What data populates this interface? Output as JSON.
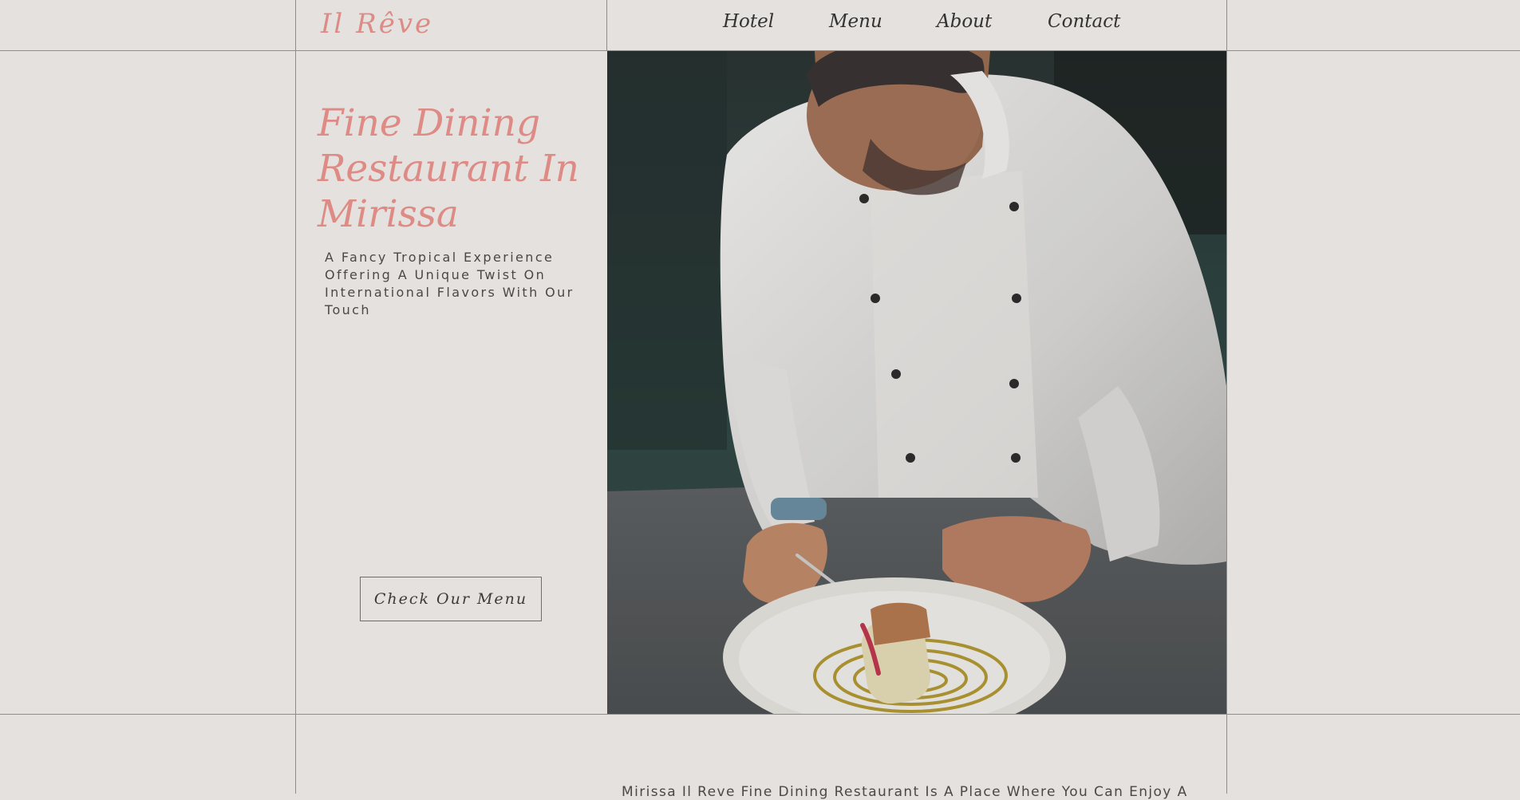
{
  "header": {
    "logo": "Il Rêve",
    "nav": [
      {
        "label": "Hotel"
      },
      {
        "label": "Menu"
      },
      {
        "label": "About"
      },
      {
        "label": "Contact"
      }
    ]
  },
  "hero": {
    "title": "Fine Dining Restaurant In Mirissa",
    "subtitle": "A Fancy Tropical Experience Offering A Unique Twist On International Flavors With Our Touch",
    "cta_label": "Check Our Menu"
  },
  "intro": {
    "text": "Mirissa Il Reve Fine Dining Restaurant Is A Place Where You Can Enjoy A"
  },
  "colors": {
    "background": "#e4e1de",
    "accent": "#de8a85",
    "grid_line": "#8f8c89",
    "text": "#4a4848"
  }
}
